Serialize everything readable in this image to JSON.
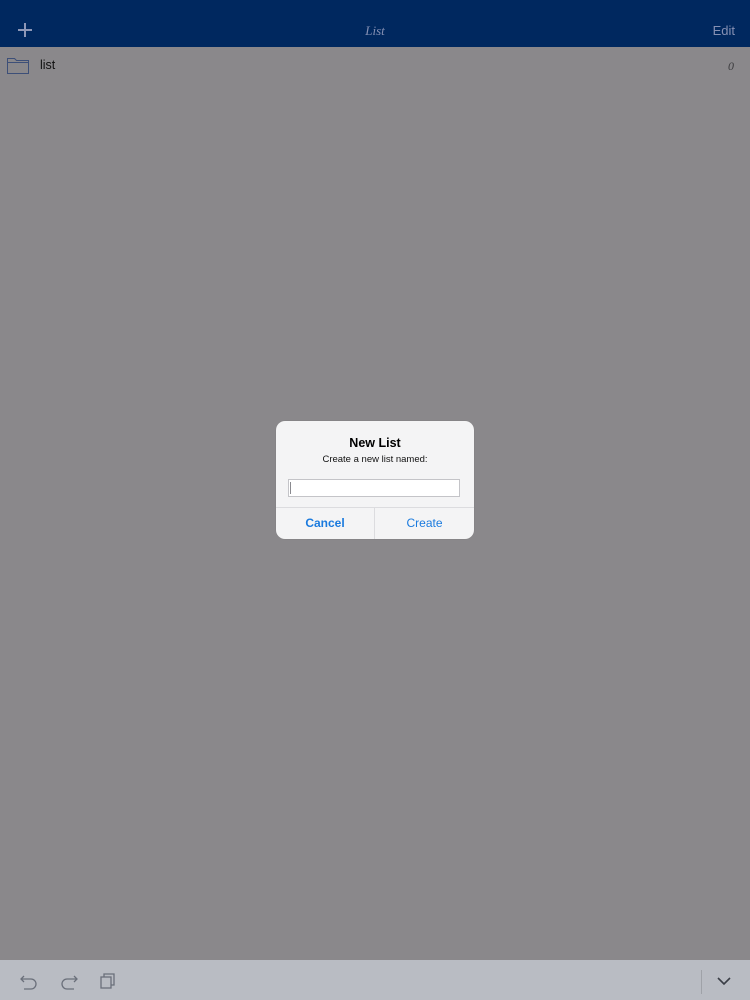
{
  "navbar": {
    "title": "List",
    "edit_label": "Edit",
    "add_icon": "plus-icon"
  },
  "list": {
    "items": [
      {
        "label": "list",
        "count": "0",
        "icon": "folder-icon"
      }
    ]
  },
  "alert": {
    "title": "New List",
    "message": "Create a new list named:",
    "input_value": "",
    "cancel_label": "Cancel",
    "create_label": "Create"
  },
  "toolbar": {
    "icons": [
      "undo-icon",
      "redo-icon",
      "copy-icon",
      "chevron-down-icon"
    ]
  },
  "colors": {
    "navbar_bg": "#00285f",
    "accent": "#1a7ade",
    "dim_background": "#8a888b",
    "toolbar_bg": "#b9bcc3"
  }
}
